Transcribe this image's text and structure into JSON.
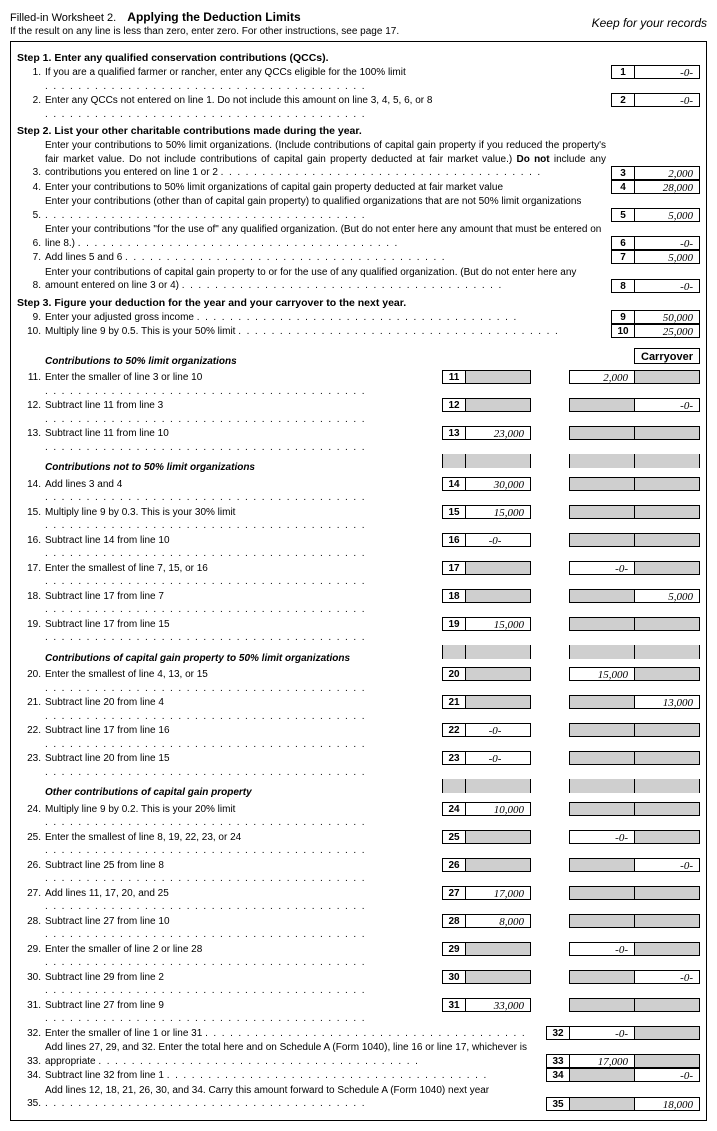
{
  "header": {
    "title_prefix": "Filled-in Worksheet 2.",
    "title_main": "Applying the Deduction Limits",
    "subtitle": "If the result on any line is less than zero, enter zero. For other instructions, see page 17.",
    "keep": "Keep for your records"
  },
  "carryover_label": "Carryover",
  "steps": {
    "s1": "Step 1. Enter any qualified conservation contributions (QCCs).",
    "s2": "Step 2. List your other charitable contributions made during the year.",
    "s3": "Step 3. Figure your deduction for the year and your carryover to the next year."
  },
  "subheads": {
    "a": "Contributions to 50% limit organizations",
    "b": "Contributions not to 50% limit organizations",
    "c": "Contributions of capital gain property to 50% limit organizations",
    "d": "Other contributions of capital gain property"
  },
  "lines": {
    "l1": {
      "n": "1.",
      "t": "If you are a qualified farmer or rancher, enter any QCCs eligible for the 100% limit",
      "label": "1",
      "v": "-0-"
    },
    "l2": {
      "n": "2.",
      "t": "Enter any QCCs not entered on line 1. Do not include this amount on line 3, 4, 5, 6, or 8",
      "label": "2",
      "v": "-0-"
    },
    "l3": {
      "n": "3.",
      "t": "Enter your contributions to 50% limit organizations. (Include contributions of capital gain property if you reduced the property's fair market value. Do not include contributions of capital gain property deducted at fair market value.) ",
      "t2": "Do not",
      "t3": " include any contributions you entered on line 1 or 2",
      "label": "3",
      "v": "2,000"
    },
    "l4": {
      "n": "4.",
      "t": "Enter your contributions to 50% limit organizations of capital gain property deducted at fair market value",
      "label": "4",
      "v": "28,000"
    },
    "l5": {
      "n": "5.",
      "t": "Enter your contributions (other than of capital gain property) to qualified organizations that are not 50% limit organizations",
      "label": "5",
      "v": "5,000"
    },
    "l6": {
      "n": "6.",
      "t": "Enter your contributions \"for the use of\" any qualified organization. (But do not enter here any amount that must be entered on line 8.)",
      "label": "6",
      "v": "-0-"
    },
    "l7": {
      "n": "7.",
      "t": "Add lines 5 and 6",
      "label": "7",
      "v": "5,000"
    },
    "l8": {
      "n": "8.",
      "t": "Enter your contributions of capital gain property to or for the use of any qualified organization. (But do not enter here any amount entered on line 3 or 4)",
      "label": "8",
      "v": "-0-"
    },
    "l9": {
      "n": "9.",
      "t": "Enter your adjusted gross income",
      "label": "9",
      "v": "50,000"
    },
    "l10": {
      "n": "10.",
      "t": "Multiply line 9 by 0.5. This is your 50% limit",
      "label": "10",
      "v": "25,000"
    },
    "l11": {
      "n": "11.",
      "t": "Enter the smaller of line 3 or line 10",
      "label": "11",
      "a": "",
      "c": "2,000",
      "d": ""
    },
    "l12": {
      "n": "12.",
      "t": "Subtract line 11 from line 3",
      "label": "12",
      "a": "",
      "c": "",
      "d": "-0-"
    },
    "l13": {
      "n": "13.",
      "t": "Subtract line 11 from line 10",
      "label": "13",
      "a": "23,000",
      "c": "",
      "d": ""
    },
    "l14": {
      "n": "14.",
      "t": "Add lines 3 and 4",
      "label": "14",
      "a": "30,000",
      "c": "",
      "d": ""
    },
    "l15": {
      "n": "15.",
      "t": "Multiply line 9 by 0.3. This is your 30% limit",
      "label": "15",
      "a": "15,000",
      "c": "",
      "d": ""
    },
    "l16": {
      "n": "16.",
      "t": "Subtract line 14 from line 10",
      "label": "16",
      "a": "-0-",
      "c": "",
      "d": ""
    },
    "l17": {
      "n": "17.",
      "t": "Enter the smallest of line 7, 15, or 16",
      "label": "17",
      "a": "",
      "c": "-0-",
      "d": ""
    },
    "l18": {
      "n": "18.",
      "t": "Subtract line 17 from line 7",
      "label": "18",
      "a": "",
      "c": "",
      "d": "5,000"
    },
    "l19": {
      "n": "19.",
      "t": "Subtract line 17 from line 15",
      "label": "19",
      "a": "15,000",
      "c": "",
      "d": ""
    },
    "l20": {
      "n": "20.",
      "t": "Enter the smallest of line 4, 13, or 15",
      "label": "20",
      "a": "",
      "c": "15,000",
      "d": ""
    },
    "l21": {
      "n": "21.",
      "t": "Subtract line 20 from line 4",
      "label": "21",
      "a": "",
      "c": "",
      "d": "13,000"
    },
    "l22": {
      "n": "22.",
      "t": "Subtract line 17 from line 16",
      "label": "22",
      "a": "-0-",
      "c": "",
      "d": ""
    },
    "l23": {
      "n": "23.",
      "t": "Subtract line 20 from line 15",
      "label": "23",
      "a": "-0-",
      "c": "",
      "d": ""
    },
    "l24": {
      "n": "24.",
      "t": "Multiply line 9 by 0.2. This is your 20% limit",
      "label": "24",
      "a": "10,000",
      "c": "",
      "d": ""
    },
    "l25": {
      "n": "25.",
      "t": "Enter the smallest of line 8, 19, 22, 23, or 24",
      "label": "25",
      "a": "",
      "c": "-0-",
      "d": ""
    },
    "l26": {
      "n": "26.",
      "t": "Subtract line 25 from line 8",
      "label": "26",
      "a": "",
      "c": "",
      "d": "-0-"
    },
    "l27": {
      "n": "27.",
      "t": "Add lines 11, 17, 20, and 25",
      "label": "27",
      "a": "17,000",
      "c": "",
      "d": ""
    },
    "l28": {
      "n": "28.",
      "t": "Subtract line 27 from line 10",
      "label": "28",
      "a": "8,000",
      "c": "",
      "d": ""
    },
    "l29": {
      "n": "29.",
      "t": "Enter the smaller of line 2 or line 28",
      "label": "29",
      "a": "",
      "c": "-0-",
      "d": ""
    },
    "l30": {
      "n": "30.",
      "t": "Subtract line 29 from line 2",
      "label": "30",
      "a": "",
      "c": "",
      "d": "-0-"
    },
    "l31": {
      "n": "31.",
      "t": "Subtract line 27 from line 9",
      "label": "31",
      "a": "33,000",
      "c": "",
      "d": ""
    },
    "l32": {
      "n": "32.",
      "t": "Enter the smaller of line 1 or line 31",
      "label": "32",
      "c": "-0-"
    },
    "l33": {
      "n": "33.",
      "t": "Add lines 27, 29, and 32. Enter the total here and on Schedule A (Form 1040), line 16 or line 17, whichever is appropriate",
      "label": "33",
      "c": "17,000"
    },
    "l34": {
      "n": "34.",
      "t": "Subtract line 32 from line 1",
      "label": "34",
      "d": "-0-"
    },
    "l35": {
      "n": "35.",
      "t": "Add lines 12, 18, 21, 26, 30, and 34. Carry this amount forward to Schedule A (Form 1040) next year",
      "label": "35",
      "d": "18,000"
    }
  }
}
